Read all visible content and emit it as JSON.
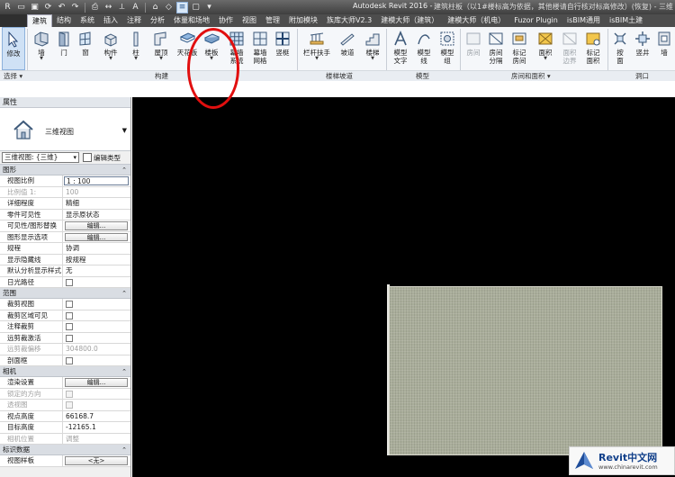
{
  "titlebar": {
    "app_title": "Autodesk Revit 2016 -",
    "document_title": "建筑柱板（以1#楼标高为依据，其他楼请自行核对标高修改）(恢复) - 三维"
  },
  "tabs": [
    {
      "label": "建筑"
    },
    {
      "label": "结构"
    },
    {
      "label": "系统"
    },
    {
      "label": "插入"
    },
    {
      "label": "注释"
    },
    {
      "label": "分析"
    },
    {
      "label": "体量和场地"
    },
    {
      "label": "协作"
    },
    {
      "label": "视图"
    },
    {
      "label": "管理"
    },
    {
      "label": "附加模块"
    },
    {
      "label": "族库大师V2.3"
    },
    {
      "label": "建模大师（建筑）"
    },
    {
      "label": "建模大师（机电）"
    },
    {
      "label": "Fuzor Plugin"
    },
    {
      "label": "isBIM通用"
    },
    {
      "label": "isBIM土建"
    }
  ],
  "ribbon": {
    "buttons": {
      "modify": "修改",
      "wall": "墙",
      "door": "门",
      "window": "窗",
      "component": "构件",
      "column": "柱",
      "roof": "屋顶",
      "ceiling": "天花板",
      "floor": "楼板",
      "curtain_system": "幕墙\n系统",
      "curtain_grid": "幕墙\n网格",
      "mullion": "竖梃",
      "railing": "栏杆扶手",
      "ramp": "坡道",
      "stair": "楼梯",
      "model_text": "模型\n文字",
      "model_line": "模型\n线",
      "model_group": "模型\n组",
      "room": "房间",
      "room_separator": "房间\n分隔",
      "tag_room": "标记\n房间",
      "area": "面积",
      "area_boundary": "面积\n边界",
      "tag_area": "标记\n面积",
      "by_face": "按\n面",
      "shaft": "竖井",
      "wall_opening": "墙"
    },
    "panels": {
      "select": "选择 ▾",
      "build": "构建",
      "circulation": "楼梯坡道",
      "model": "模型",
      "room_area": "房间和面积 ▾",
      "opening": "洞口"
    }
  },
  "properties": {
    "header": "属性",
    "type_name": "三维视图",
    "view_selector": "三维视图: {三维}",
    "edit_type": "编辑类型",
    "sections": [
      {
        "name": "图形",
        "rows": [
          {
            "key": "视图比例",
            "value": "1 : 100",
            "kind": "input"
          },
          {
            "key": "比例值 1:",
            "value": "100",
            "kind": "dim"
          },
          {
            "key": "详细程度",
            "value": "精细",
            "kind": "text"
          },
          {
            "key": "零件可见性",
            "value": "显示原状态",
            "kind": "text"
          },
          {
            "key": "可见性/图形替换",
            "value": "编辑...",
            "kind": "button"
          },
          {
            "key": "图形显示选项",
            "value": "编辑...",
            "kind": "button"
          },
          {
            "key": "规程",
            "value": "协调",
            "kind": "text"
          },
          {
            "key": "显示隐藏线",
            "value": "按规程",
            "kind": "text"
          },
          {
            "key": "默认分析显示样式",
            "value": "无",
            "kind": "text"
          },
          {
            "key": "日光路径",
            "value": "",
            "kind": "check"
          }
        ]
      },
      {
        "name": "范围",
        "rows": [
          {
            "key": "裁剪视图",
            "value": "",
            "kind": "check"
          },
          {
            "key": "裁剪区域可见",
            "value": "",
            "kind": "check"
          },
          {
            "key": "注释裁剪",
            "value": "",
            "kind": "check"
          },
          {
            "key": "远剪裁激活",
            "value": "",
            "kind": "check"
          },
          {
            "key": "远剪裁偏移",
            "value": "304800.0",
            "kind": "dim"
          },
          {
            "key": "剖面框",
            "value": "",
            "kind": "check"
          }
        ]
      },
      {
        "name": "相机",
        "rows": [
          {
            "key": "渲染设置",
            "value": "编辑...",
            "kind": "button"
          },
          {
            "key": "锁定的方向",
            "value": "",
            "kind": "checkdim"
          },
          {
            "key": "透视图",
            "value": "",
            "kind": "checkdim"
          },
          {
            "key": "视点高度",
            "value": "66168.7",
            "kind": "text"
          },
          {
            "key": "目标高度",
            "value": "-12165.1",
            "kind": "text"
          },
          {
            "key": "相机位置",
            "value": "调整",
            "kind": "dim"
          }
        ]
      },
      {
        "name": "标识数据",
        "rows": [
          {
            "key": "视图样板",
            "value": "<无>",
            "kind": "button"
          }
        ]
      }
    ]
  },
  "watermark": {
    "brand": "Revit中文网",
    "url": "www.chinarevit.com"
  },
  "colors": {
    "canvas_bg": "#000000",
    "slab_fill": "#a9ad9a",
    "annotation_circle": "#e10f0f",
    "active_ribbon": "#cfe1f5"
  }
}
